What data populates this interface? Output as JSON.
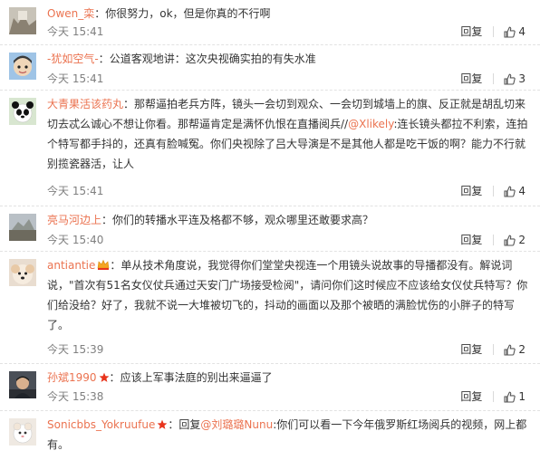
{
  "comments": [
    {
      "username": "Owen_栾",
      "text": "你很努力，ok，但是你真的不行啊",
      "time": "今天 15:41",
      "reply_label": "回复",
      "likes": "4"
    },
    {
      "username": "-犹如空气-",
      "text": "公道客观地讲：这次央视确实拍的有失水准",
      "time": "今天 15:41",
      "reply_label": "回复",
      "likes": "3"
    },
    {
      "username": "大青果活该药丸",
      "text_before": "那帮逼拍老兵方阵，镜头一会切到观众、一会切到城墙上的旗、反正就是胡乱切来切去忒么诚心不想让你看。那帮逼肯定是满怀仇恨在直播阅兵//",
      "mention": "@Xlikely",
      "text_after": ":连长镜头都拉不利索，连拍个特写都手抖的，还真有脸喊冤。你们央视除了吕大导演是不是其他人都是吃干饭的啊？能力不行就别揽瓷器活，让人",
      "time": "今天 15:41",
      "reply_label": "回复",
      "likes": "4"
    },
    {
      "username": "亮马河边上",
      "text": "你们的转播水平连及格都不够，观众哪里还敢要求高？",
      "time": "今天 15:40",
      "reply_label": "回复",
      "likes": "2"
    },
    {
      "username": "antiantie",
      "text": "单从技术角度说，我觉得你们堂堂央视连一个用镜头说故事的导播都没有。解说词说，\"首次有51名女仪仗兵通过天安门广场接受检阅\"，请问你们这时候应不应该给女仪仗兵特写？你们给没给？好了，我就不说一大堆被切飞的，抖动的画面以及那个被晒的满脸忧伤的小胖子的特写了。",
      "time": "今天 15:39",
      "reply_label": "回复",
      "likes": "2"
    },
    {
      "username": "孙斌1990",
      "text": "应该上军事法庭的别出来逼逼了",
      "time": "今天 15:38",
      "reply_label": "回复",
      "likes": "1"
    },
    {
      "username": "Sonicbbs_Yokruufue",
      "text_before": "回复",
      "mention": "@刘璐璐Nunu",
      "text_after": ":你们可以看一下今年俄罗斯红场阅兵的视频，网上都有。"
    }
  ],
  "colors": {
    "username": "#eb7350",
    "text": "#333333",
    "time": "#808080",
    "star_badge": "#e8341c",
    "crown_badge": "#f5a623"
  },
  "icons": {
    "like": "thumbs-up-icon",
    "crown_badge": "vip-crown-icon",
    "star_badge": "star-badge-icon"
  }
}
